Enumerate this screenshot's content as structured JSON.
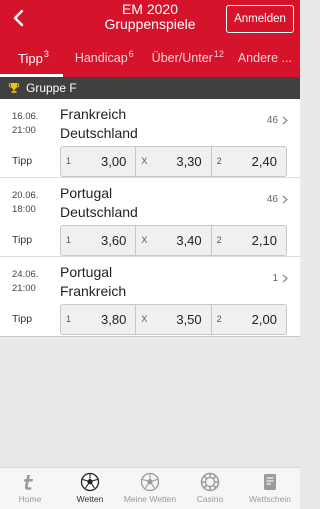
{
  "header": {
    "title": "EM 2020",
    "subtitle": "Gruppenspiele",
    "login_label": "Anmelden"
  },
  "tabs": [
    {
      "label": "Tipp",
      "count": "3"
    },
    {
      "label": "Handicap",
      "count": "6"
    },
    {
      "label": "Über/Unter",
      "count": "12"
    },
    {
      "label": "Andere ...",
      "count": ""
    }
  ],
  "group": {
    "label": "Gruppe F"
  },
  "matches": [
    {
      "date": "16.06.",
      "time": "21:00",
      "home": "Frankreich",
      "away": "Deutschland",
      "markets": "46",
      "tipp_label": "Tipp",
      "odds": [
        {
          "key": "1",
          "value": "3,00"
        },
        {
          "key": "X",
          "value": "3,30"
        },
        {
          "key": "2",
          "value": "2,40"
        }
      ]
    },
    {
      "date": "20.06.",
      "time": "18:00",
      "home": "Portugal",
      "away": "Deutschland",
      "markets": "46",
      "tipp_label": "Tipp",
      "odds": [
        {
          "key": "1",
          "value": "3,60"
        },
        {
          "key": "X",
          "value": "3,40"
        },
        {
          "key": "2",
          "value": "2,10"
        }
      ]
    },
    {
      "date": "24.06.",
      "time": "21:00",
      "home": "Portugal",
      "away": "Frankreich",
      "markets": "1",
      "tipp_label": "Tipp",
      "odds": [
        {
          "key": "1",
          "value": "3,80"
        },
        {
          "key": "X",
          "value": "3,50"
        },
        {
          "key": "2",
          "value": "2,00"
        }
      ]
    }
  ],
  "bottom_nav": [
    {
      "label": "Home",
      "icon": "tipico-t-icon"
    },
    {
      "label": "Wetten",
      "icon": "soccer-ball-icon",
      "active": true
    },
    {
      "label": "Meine Wetten",
      "icon": "my-bets-icon"
    },
    {
      "label": "Casino",
      "icon": "casino-chip-icon"
    },
    {
      "label": "Wettschein",
      "icon": "bet-slip-icon"
    }
  ],
  "colors": {
    "brand_red": "#d5142b",
    "group_bar": "#404040"
  }
}
